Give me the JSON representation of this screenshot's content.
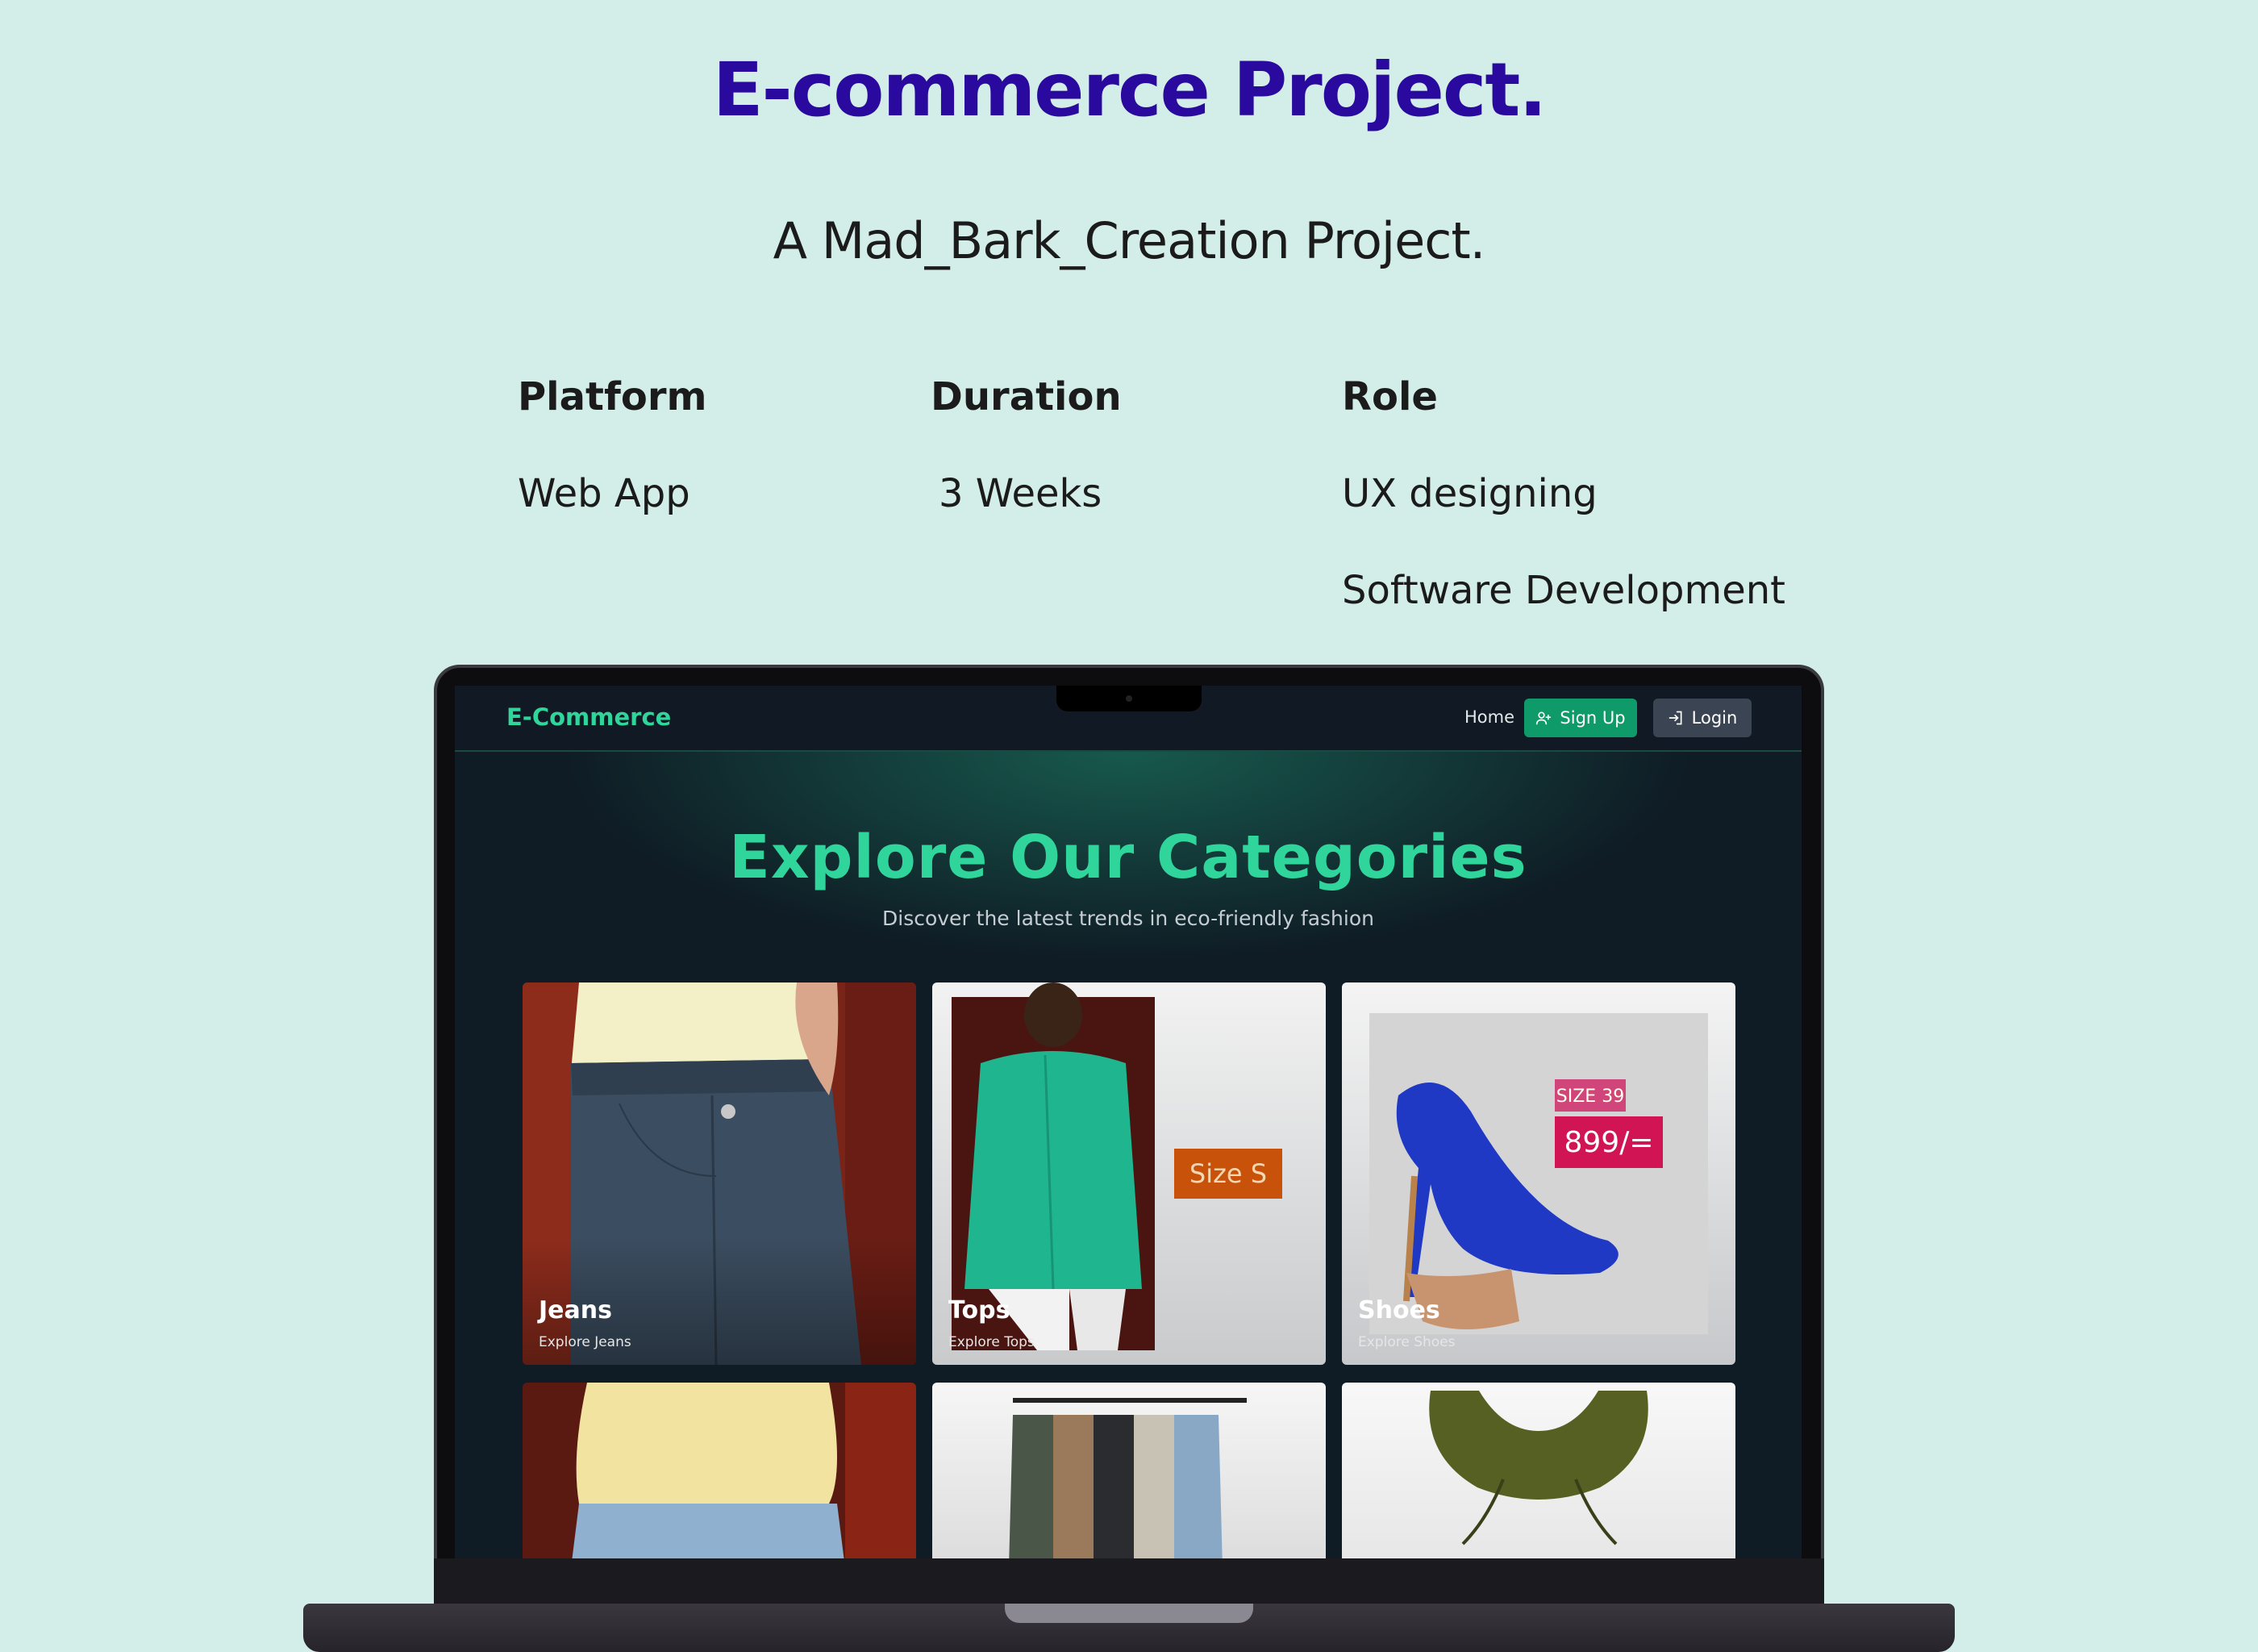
{
  "page": {
    "title": "E-commerce Project.",
    "subtitle": "A Mad_Bark_Creation Project."
  },
  "info": {
    "platform": {
      "heading": "Platform",
      "value": "Web App"
    },
    "duration": {
      "heading": "Duration",
      "value": "3 Weeks"
    },
    "role": {
      "heading": "Role",
      "values": [
        "UX designing",
        "Software Development"
      ]
    }
  },
  "app": {
    "brand": "E-Commerce",
    "nav": {
      "home": "Home",
      "signup": "Sign Up",
      "login": "Login"
    },
    "hero": {
      "title": "Explore Our Categories",
      "subtitle": "Discover the latest trends in eco-friendly fashion"
    },
    "categories": [
      {
        "label": "Jeans",
        "sub": "Explore Jeans"
      },
      {
        "label": "Tops",
        "sub": "Explore Tops",
        "tag": "Size S"
      },
      {
        "label": "Shoes",
        "sub": "Explore Shoes",
        "tag_size": "SIZE 39",
        "tag_price": "899/="
      }
    ]
  },
  "colors": {
    "background": "#d3eee8",
    "title": "#2a0a9e",
    "accent": "#2fd59a",
    "signup": "#0f9a6a",
    "screen_bg": "#0f1c25"
  }
}
